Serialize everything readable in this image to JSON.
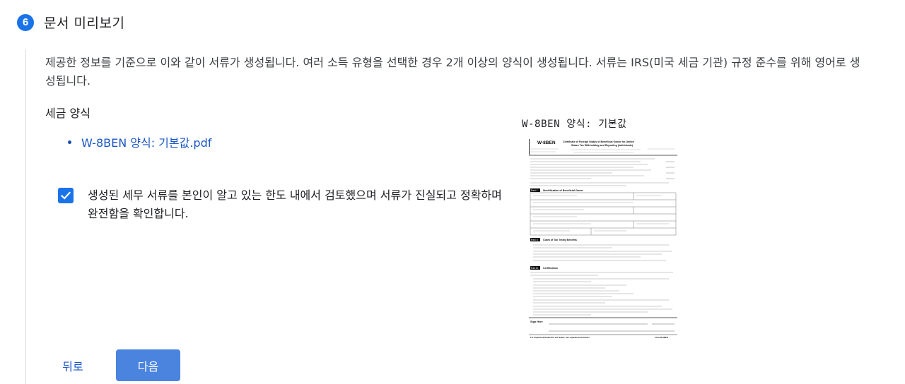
{
  "step": {
    "number": "6",
    "title": "문서 미리보기"
  },
  "description": {
    "line1": "제공한 정보를 기준으로 이와 같이 서류가 생성됩니다. 여러 소득 유형을 선택한 경우 2개 이상의 양식이 생성됩니다. 서류는 IRS(미국 세금 기관) 규정 준수를 위해 영어로 생",
    "line2": "성됩니다."
  },
  "tax_forms": {
    "label": "세금 양식",
    "items": [
      {
        "label": "W-8BEN 양식: 기본값.pdf"
      }
    ]
  },
  "confirmation": {
    "checked": true,
    "text": "생성된 세무 서류를 본인이 알고 있는 한도 내에서 검토했으며 서류가 진실되고 정확하며 완전함을 확인합니다."
  },
  "buttons": {
    "back": "뒤로",
    "next": "다음"
  },
  "preview": {
    "title": "W-8BEN 양식: 기본값",
    "form_id": "W-8BEN",
    "heading_line1": "Certificate of Foreign Status of Beneficial Owner for United",
    "heading_line2": "States Tax Withholding and Reporting (Individuals)",
    "part1": "Part I",
    "part1_title": "Identification of Beneficial Owner",
    "part2": "Part II",
    "part2_title": "Claim of Tax Treaty Benefits",
    "part3": "Part III",
    "part3_title": "Certification",
    "sign_here": "Sign Here",
    "footer_left": "For Paperwork Reduction Act Notice, see separate instructions.",
    "footer_right": "Form W-8BEN"
  },
  "colors": {
    "accent": "#1a73e8",
    "link": "#1a56c4",
    "button_primary": "#4a84df"
  }
}
